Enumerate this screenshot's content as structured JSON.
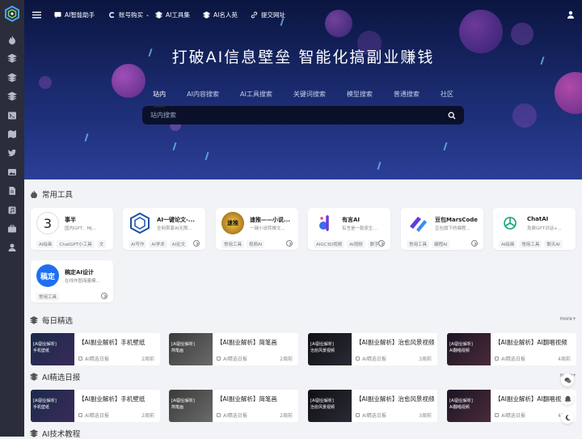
{
  "nav": [
    {
      "label": "AI智能助手",
      "icon": "chat-icon"
    },
    {
      "label": "账号购买",
      "icon": "c-icon"
    },
    {
      "label": "AI工具集",
      "icon": "layers-icon"
    },
    {
      "label": "AI名人苑",
      "icon": "layers-icon"
    },
    {
      "label": "提交网址",
      "icon": "link-icon"
    }
  ],
  "hero": {
    "title": "打破AI信息壁垒 智能化搞副业赚钱",
    "tabs": [
      "站内",
      "AI内容搜索",
      "AI工具搜索",
      "关键词搜索",
      "模型搜索",
      "普通搜索",
      "社区"
    ],
    "search_placeholder": "站内搜索"
  },
  "common_tools": {
    "title": "常用工具",
    "items": [
      {
        "name": "事半",
        "desc": "国内GPT、MJ...",
        "tags": [
          "AI绘画",
          "ChatGPT小工具",
          "文"
        ],
        "logo_text": "3"
      },
      {
        "name": "AI一键论文-...",
        "desc": "全网首家AI无限...",
        "tags": [
          "AI写作",
          "AI学术",
          "AI论文"
        ],
        "logo_text": ""
      },
      {
        "name": "速推——小说...",
        "desc": "一键小说转推文...",
        "tags": [
          "常用工具",
          "视频AI"
        ],
        "logo_text": "速推"
      },
      {
        "name": "有言AI",
        "desc": "有言是一款原生...",
        "tags": [
          "AIGC3D视频",
          "AI视频",
          "数字"
        ],
        "logo_text": ""
      },
      {
        "name": "豆包MarsCode",
        "desc": "豆包旗下的编程...",
        "tags": [
          "常用工具",
          "编程AI"
        ],
        "logo_text": ""
      },
      {
        "name": "ChatAI",
        "desc": "免费GPT对话+...",
        "tags": [
          "AI绘画",
          "常用工具",
          "聊天AI"
        ],
        "logo_text": ""
      },
      {
        "name": "稿定AI设计",
        "desc": "在线作图海量模...",
        "tags": [
          "常用工具"
        ],
        "logo_text": "稿定"
      }
    ]
  },
  "daily_picks": {
    "title": "每日精选",
    "more": "more+",
    "posts": [
      {
        "title": "【AI副业解析】手机壁纸",
        "category": "AI精选日报",
        "time": "2周前",
        "thumb": [
          "[AI副业解析]",
          "手机壁纸"
        ]
      },
      {
        "title": "【AI副业解析】简笔画",
        "category": "AI精选日报",
        "time": "2周前",
        "thumb": [
          "[AI副业解析]",
          "简笔画"
        ]
      },
      {
        "title": "【AI副业解析】治愈风景视频",
        "category": "AI精选日报",
        "time": "3周前",
        "thumb": [
          "[AI副业解析]",
          "治愈风景视频"
        ]
      },
      {
        "title": "【AI副业解析】AI翻唱视频",
        "category": "AI精选日报",
        "time": "4周前",
        "thumb": [
          "[AI副业解析]",
          "AI翻唱视频"
        ]
      }
    ]
  },
  "ai_daily": {
    "title": "AI精选日报",
    "more": "more+",
    "posts": [
      {
        "title": "【AI副业解析】手机壁纸",
        "category": "AI精选日报",
        "time": "2周前",
        "thumb": [
          "[AI副业解析]",
          "手机壁纸"
        ]
      },
      {
        "title": "【AI副业解析】简笔画",
        "category": "AI精选日报",
        "time": "2周前",
        "thumb": [
          "[AI副业解析]",
          "简笔画"
        ]
      },
      {
        "title": "【AI副业解析】治愈风景视频",
        "category": "AI精选日报",
        "time": "3周前",
        "thumb": [
          "[AI副业解析]",
          "治愈风景视频"
        ]
      },
      {
        "title": "【AI副业解析】AI翻唱视频",
        "category": "AI精选日报",
        "time": "4周前",
        "thumb": [
          "[AI副业解析]",
          "AI翻唱视频"
        ]
      }
    ]
  },
  "tech_tutorials": {
    "title": "AI技术教程"
  },
  "colors": {
    "sidebar": "#2b2d3a",
    "hero_top": "#0b1540",
    "hero_bottom": "#2b3e96",
    "search_bg": "#0a0e23",
    "accent": "#3a6df0"
  }
}
